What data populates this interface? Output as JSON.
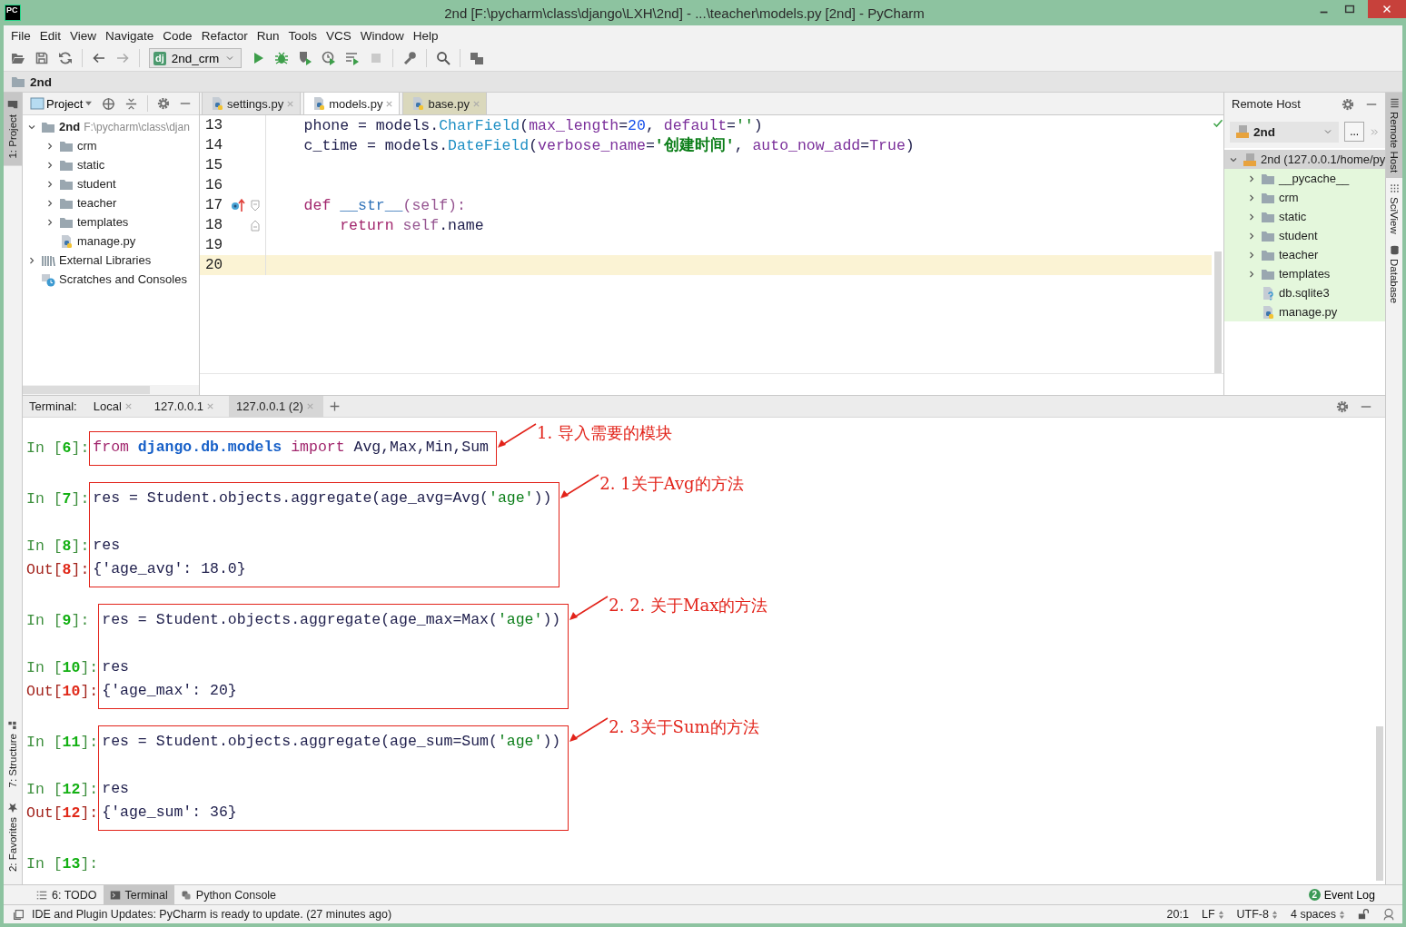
{
  "window": {
    "logo": "PC",
    "title": "2nd [F:\\pycharm\\class\\django\\LXH\\2nd] - ...\\teacher\\models.py [2nd] - PyCharm"
  },
  "menu": [
    "File",
    "Edit",
    "View",
    "Navigate",
    "Code",
    "Refactor",
    "Run",
    "Tools",
    "VCS",
    "Window",
    "Help"
  ],
  "toolbar": [
    {
      "kind": "open",
      "disabled": false
    },
    {
      "kind": "save",
      "disabled": false
    },
    {
      "kind": "sync",
      "disabled": false
    },
    {
      "kind": "separator"
    },
    {
      "kind": "back",
      "disabled": false
    },
    {
      "kind": "forward",
      "disabled": true
    },
    {
      "kind": "separator"
    },
    {
      "kind": "config",
      "badge": "dj",
      "label": "2nd_crm"
    },
    {
      "kind": "run",
      "disabled": false
    },
    {
      "kind": "debug",
      "disabled": false
    },
    {
      "kind": "coverage",
      "disabled": false
    },
    {
      "kind": "profile",
      "disabled": false
    },
    {
      "kind": "concurrency",
      "disabled": false
    },
    {
      "kind": "stop",
      "disabled": true
    },
    {
      "kind": "separator"
    },
    {
      "kind": "wrench",
      "disabled": false
    },
    {
      "kind": "separator"
    },
    {
      "kind": "search",
      "disabled": false
    },
    {
      "kind": "separator"
    },
    {
      "kind": "tasks",
      "disabled": false
    }
  ],
  "breadcrumb": {
    "label": "2nd"
  },
  "left_strip": {
    "top": [
      {
        "label": "1: Project",
        "kind": "project",
        "selected": true
      }
    ],
    "bottom": [
      {
        "label": "7: Structure",
        "kind": "structure",
        "selected": false
      },
      {
        "label": "2: Favorites",
        "kind": "favorites",
        "selected": false
      }
    ]
  },
  "project": {
    "title": "Project",
    "tree": [
      {
        "label": "2nd",
        "path": "F:\\pycharm\\class\\djan",
        "kind": "folder",
        "expanded": true,
        "children": [
          {
            "label": "crm",
            "kind": "folder",
            "expanded": false
          },
          {
            "label": "static",
            "kind": "folder",
            "expanded": false
          },
          {
            "label": "student",
            "kind": "folder",
            "expanded": false
          },
          {
            "label": "teacher",
            "kind": "folder",
            "expanded": false
          },
          {
            "label": "templates",
            "kind": "folder",
            "expanded": false
          },
          {
            "label": "manage.py",
            "kind": "python-file"
          }
        ]
      },
      {
        "label": "External Libraries",
        "kind": "libraries",
        "expanded": false
      },
      {
        "label": "Scratches and Consoles",
        "kind": "scratches"
      }
    ]
  },
  "editor": {
    "tabs": [
      {
        "label": "settings.py",
        "selected": false,
        "color": "#e3e3e3"
      },
      {
        "label": "models.py",
        "selected": true
      },
      {
        "label": "base.py",
        "selected": false,
        "color": "#dad8bc"
      }
    ],
    "lines": [
      {
        "number": "13",
        "current": false,
        "override_marker": false,
        "fold_start": false,
        "fold_end": false,
        "tokens": [
          {
            "text": "    phone = models.",
            "kind": "plain"
          },
          {
            "text": "CharField",
            "kind": "class"
          },
          {
            "text": "(",
            "kind": "plain"
          },
          {
            "text": "max_length",
            "kind": "param"
          },
          {
            "text": "=",
            "kind": "plain"
          },
          {
            "text": "20",
            "kind": "number"
          },
          {
            "text": ", ",
            "kind": "plain"
          },
          {
            "text": "default",
            "kind": "param"
          },
          {
            "text": "=",
            "kind": "plain"
          },
          {
            "text": "''",
            "kind": "string"
          },
          {
            "text": ")",
            "kind": "plain"
          }
        ]
      },
      {
        "number": "14",
        "current": false,
        "override_marker": false,
        "fold_start": false,
        "fold_end": false,
        "tokens": [
          {
            "text": "    c_time = models.",
            "kind": "plain"
          },
          {
            "text": "DateField",
            "kind": "class"
          },
          {
            "text": "(",
            "kind": "plain"
          },
          {
            "text": "verbose_name",
            "kind": "param"
          },
          {
            "text": "=",
            "kind": "plain"
          },
          {
            "text": "'创建时间'",
            "kind": "string-bold"
          },
          {
            "text": ", ",
            "kind": "plain"
          },
          {
            "text": "auto_now_add",
            "kind": "param"
          },
          {
            "text": "=",
            "kind": "plain"
          },
          {
            "text": "True",
            "kind": "param"
          },
          {
            "text": ")",
            "kind": "plain"
          }
        ]
      },
      {
        "number": "15",
        "current": false,
        "override_marker": false,
        "fold_start": false,
        "fold_end": false
      },
      {
        "number": "16",
        "current": false,
        "override_marker": false,
        "fold_start": false,
        "fold_end": false
      },
      {
        "number": "17",
        "current": false,
        "override_marker": true,
        "fold_start": true,
        "fold_end": false,
        "tokens": [
          {
            "text": "    def",
            "kind": "keyword"
          },
          {
            "text": " __str__",
            "kind": "dunder"
          },
          {
            "text": "(",
            "kind": "self"
          },
          {
            "text": "self",
            "kind": "self"
          },
          {
            "text": "):",
            "kind": "self"
          }
        ]
      },
      {
        "number": "18",
        "current": false,
        "override_marker": false,
        "fold_start": false,
        "fold_end": true,
        "tokens": [
          {
            "text": "        return",
            "kind": "keyword"
          },
          {
            "text": " self",
            "kind": "self"
          },
          {
            "text": ".name",
            "kind": "plain"
          }
        ]
      },
      {
        "number": "19",
        "current": false,
        "override_marker": false,
        "fold_start": false,
        "fold_end": false
      },
      {
        "number": "20",
        "current": true,
        "override_marker": false,
        "fold_start": false,
        "fold_end": false
      }
    ]
  },
  "remote": {
    "title": "Remote Host",
    "server": "2nd",
    "more": "...",
    "tree": [
      {
        "label": "2nd (127.0.0.1/home/py",
        "kind": "server",
        "expanded": true,
        "selected": true,
        "children": [
          {
            "label": "__pycache__",
            "kind": "folder",
            "expanded": false,
            "selected": false
          },
          {
            "label": "crm",
            "kind": "folder",
            "expanded": false,
            "selected": false
          },
          {
            "label": "static",
            "kind": "folder",
            "expanded": false,
            "selected": false
          },
          {
            "label": "student",
            "kind": "folder",
            "expanded": false,
            "selected": false
          },
          {
            "label": "teacher",
            "kind": "folder",
            "expanded": false,
            "selected": false
          },
          {
            "label": "templates",
            "kind": "folder",
            "expanded": false,
            "selected": false
          },
          {
            "label": "db.sqlite3",
            "kind": "unknown-file",
            "selected": false
          },
          {
            "label": "manage.py",
            "kind": "python-file",
            "selected": false
          }
        ]
      }
    ]
  },
  "right_strip": [
    {
      "label": "Remote Host",
      "kind": "remote",
      "selected": true
    },
    {
      "label": "SciView",
      "kind": "sciview",
      "selected": false
    },
    {
      "label": "Database",
      "kind": "database",
      "selected": false
    }
  ],
  "terminal": {
    "label": "Terminal:",
    "tabs": [
      {
        "label": "Local",
        "selected": false
      },
      {
        "label": "127.0.0.1",
        "selected": false
      },
      {
        "label": "127.0.0.1 (2)",
        "selected": true
      }
    ],
    "blocks": [
      {
        "kind": "annotated",
        "note": "1. 导入需要的模块",
        "lines": [
          {
            "kind": "input",
            "prompt": "In [**6**]:",
            "tokens": [
              {
                "text": "from ",
                "kind": "keyword"
              },
              {
                "text": "django.db.models ",
                "kind": "module"
              },
              {
                "text": "import",
                "kind": "keyword"
              },
              {
                "text": " Avg,Max,Min,Sum",
                "kind": "plain"
              }
            ]
          }
        ]
      },
      {
        "kind": "annotated",
        "note": "2. 1关于Avg的方法",
        "lines": [
          {
            "kind": "input",
            "prompt": "In [**7**]:",
            "tokens": [
              {
                "text": "res = Student.objects.aggregate(age_avg=Avg(",
                "kind": "plain"
              },
              {
                "text": "'age'",
                "kind": "string"
              },
              {
                "text": "))",
                "kind": "plain"
              }
            ]
          },
          {
            "kind": "blank"
          },
          {
            "kind": "input",
            "prompt": "In [**8**]:",
            "tokens": [
              {
                "text": "res",
                "kind": "plain"
              }
            ]
          },
          {
            "kind": "output",
            "prompt": "Out[**8**]:",
            "tokens": [
              {
                "text": "{'age_avg': 18.0}",
                "kind": "plain"
              }
            ]
          }
        ]
      },
      {
        "kind": "annotated",
        "note": "2. 2. 关于Max的方法",
        "lines": [
          {
            "kind": "input",
            "prompt": "In [**9**]:",
            "tokens": [
              {
                "text": "res = Student.objects.aggregate(age_max=Max(",
                "kind": "plain"
              },
              {
                "text": "'age'",
                "kind": "string"
              },
              {
                "text": "))",
                "kind": "plain"
              }
            ]
          },
          {
            "kind": "blank"
          },
          {
            "kind": "input",
            "prompt": "In [**10**]:",
            "tokens": [
              {
                "text": "res",
                "kind": "plain"
              }
            ]
          },
          {
            "kind": "output",
            "prompt": "Out[**10**]:",
            "tokens": [
              {
                "text": "{'age_max': 20}",
                "kind": "plain"
              }
            ]
          }
        ]
      },
      {
        "kind": "annotated",
        "note": "2. 3关于Sum的方法",
        "lines": [
          {
            "kind": "input",
            "prompt": "In [**11**]:",
            "tokens": [
              {
                "text": "res = Student.objects.aggregate(age_sum=Sum(",
                "kind": "plain"
              },
              {
                "text": "'age'",
                "kind": "string"
              },
              {
                "text": "))",
                "kind": "plain"
              }
            ]
          },
          {
            "kind": "blank"
          },
          {
            "kind": "input",
            "prompt": "In [**12**]:",
            "tokens": [
              {
                "text": "res",
                "kind": "plain"
              }
            ]
          },
          {
            "kind": "output",
            "prompt": "Out[**12**]:",
            "tokens": [
              {
                "text": "{'age_sum': 36}",
                "kind": "plain"
              }
            ]
          }
        ]
      },
      {
        "kind": "plain",
        "lines": [
          {
            "kind": "input",
            "prompt": "In [**13**]:"
          }
        ]
      }
    ]
  },
  "bottom_tools": {
    "left": [
      {
        "label": "6: TODO",
        "kind": "todo",
        "selected": false
      },
      {
        "label": "Terminal",
        "kind": "terminal",
        "selected": true
      },
      {
        "label": "Python Console",
        "kind": "python",
        "selected": false
      }
    ],
    "right": [
      {
        "label": "Event Log",
        "badge": "2"
      }
    ]
  },
  "status": {
    "message": "IDE and Plugin Updates: PyCharm is ready to update. (27 minutes ago)",
    "items": [
      {
        "label": "20:1",
        "kind": "plain"
      },
      {
        "label": "LF",
        "kind": "selector"
      },
      {
        "label": "UTF-8",
        "kind": "selector"
      },
      {
        "label": "4 spaces",
        "kind": "selector"
      }
    ]
  }
}
